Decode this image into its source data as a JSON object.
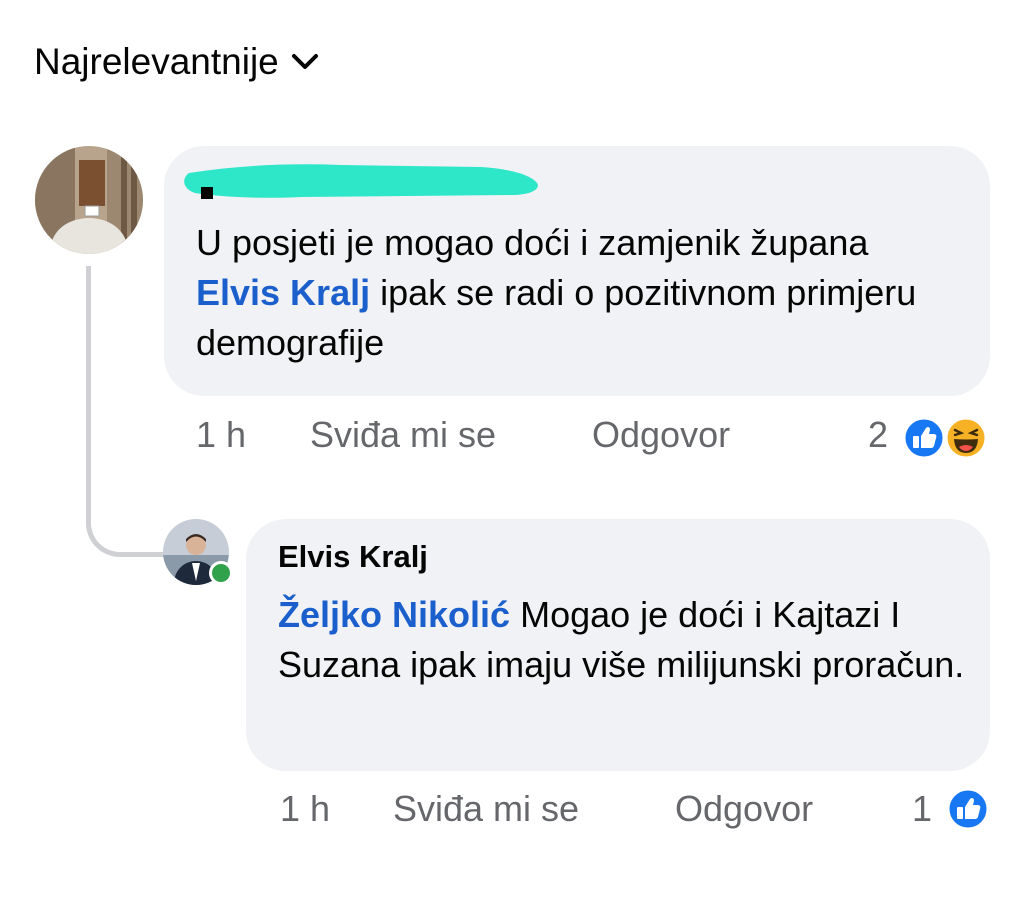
{
  "sort": {
    "label": "Najrelevantnije",
    "icon": "chevron-down-icon"
  },
  "comments": [
    {
      "author_redacted": true,
      "text_before": "U posjeti je mogao doći i zamjenik župana ",
      "mention": "Elvis Kralj",
      "text_after": " ipak se radi o pozitivnom primjeru demografije",
      "time": "1 h",
      "like_label": "Sviđa mi se",
      "reply_label": "Odgovor",
      "reaction_count": "2",
      "reactions": [
        "like-icon",
        "haha-icon"
      ],
      "reply": {
        "author": "Elvis Kralj",
        "online": true,
        "mention": "Željko Nikolić",
        "text_after": " Mogao je doći i Kajtazi I Suzana ipak imaju više milijunski proračun.",
        "time": "1 h",
        "like_label": "Sviđa mi se",
        "reply_label": "Odgovor",
        "reaction_count": "1",
        "reactions": [
          "like-icon"
        ]
      }
    }
  ],
  "colors": {
    "bubble": "#f0f2f5",
    "mention": "#1b5fcc",
    "meta": "#65676b",
    "like": "#1877f2",
    "online": "#31a24c",
    "redaction": "#2ee6c8"
  }
}
